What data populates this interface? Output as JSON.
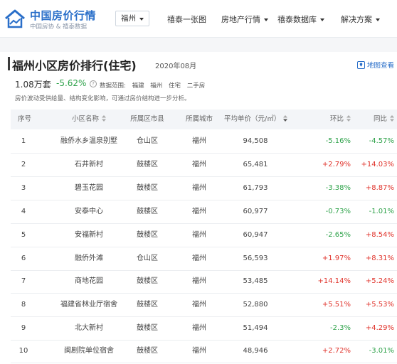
{
  "header": {
    "logo_title": "中国房价行情",
    "logo_sub": "中国房协 & 禧泰数据",
    "city": "福州",
    "nav": [
      "禧泰一张图",
      "房地产行情",
      "禧泰数据库",
      "解决方案"
    ]
  },
  "page": {
    "title": "福州小区房价排行(住宅)",
    "date": "2020年08月",
    "map_link": "地图查看",
    "count": "1.08万套",
    "change": "-5.62%",
    "scope_label": "数据范围:",
    "scope": [
      "福建",
      "福州",
      "住宅",
      "二手房"
    ],
    "note": "房价波动受供给量、结构变化影响，可通过房价结构进一步分析。"
  },
  "table": {
    "headers": {
      "rank": "序号",
      "name": "小区名称",
      "district": "所属区市县",
      "city": "所属城市",
      "price": "平均单价（元/㎡）",
      "mom": "环比",
      "yoy": "同比"
    },
    "rows": [
      {
        "rank": "1",
        "name": "融侨水乡温泉别墅",
        "district": "仓山区",
        "city": "福州",
        "price": "94,508",
        "mom": "-5.16%",
        "yoy": "-4.57%"
      },
      {
        "rank": "2",
        "name": "石井新村",
        "district": "鼓楼区",
        "city": "福州",
        "price": "65,481",
        "mom": "+2.79%",
        "yoy": "+14.03%"
      },
      {
        "rank": "3",
        "name": "碧玉花园",
        "district": "鼓楼区",
        "city": "福州",
        "price": "61,793",
        "mom": "-3.38%",
        "yoy": "+8.87%"
      },
      {
        "rank": "4",
        "name": "安泰中心",
        "district": "鼓楼区",
        "city": "福州",
        "price": "60,977",
        "mom": "-0.73%",
        "yoy": "-1.01%"
      },
      {
        "rank": "5",
        "name": "安福新村",
        "district": "鼓楼区",
        "city": "福州",
        "price": "60,947",
        "mom": "-2.65%",
        "yoy": "+8.54%"
      },
      {
        "rank": "6",
        "name": "融侨外滩",
        "district": "仓山区",
        "city": "福州",
        "price": "56,593",
        "mom": "+1.97%",
        "yoy": "+8.31%"
      },
      {
        "rank": "7",
        "name": "商地花园",
        "district": "鼓楼区",
        "city": "福州",
        "price": "53,485",
        "mom": "+14.14%",
        "yoy": "+5.24%"
      },
      {
        "rank": "8",
        "name": "福建省林业厅宿舍",
        "district": "鼓楼区",
        "city": "福州",
        "price": "52,880",
        "mom": "+5.51%",
        "yoy": "+5.53%"
      },
      {
        "rank": "9",
        "name": "北大新村",
        "district": "鼓楼区",
        "city": "福州",
        "price": "51,494",
        "mom": "-2.3%",
        "yoy": "+4.29%"
      },
      {
        "rank": "10",
        "name": "闽剧院单位宿舍",
        "district": "鼓楼区",
        "city": "福州",
        "price": "48,946",
        "mom": "+2.72%",
        "yoy": "-3.01%"
      }
    ]
  },
  "colors": {
    "accent": "#2a6fc9",
    "up": "#e0332b",
    "down": "#2ea24a"
  }
}
